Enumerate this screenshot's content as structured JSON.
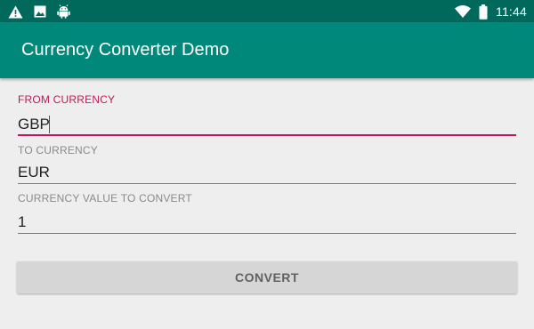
{
  "status_bar": {
    "time": "11:44",
    "icons": [
      "warning-icon",
      "image-icon",
      "android-icon",
      "wifi-icon",
      "battery-icon"
    ]
  },
  "app_bar": {
    "title": "Currency Converter Demo",
    "color": "#00897b",
    "status_color": "#00695c"
  },
  "form": {
    "from_currency": {
      "label": "FROM CURRENCY",
      "value": "GBP",
      "focused": true
    },
    "to_currency": {
      "label": "TO CURRENCY",
      "value": "EUR"
    },
    "amount": {
      "label": "CURRENCY VALUE TO CONVERT",
      "value": "1"
    }
  },
  "convert_button": {
    "label": "CONVERT"
  },
  "accent_color": "#c2185b"
}
